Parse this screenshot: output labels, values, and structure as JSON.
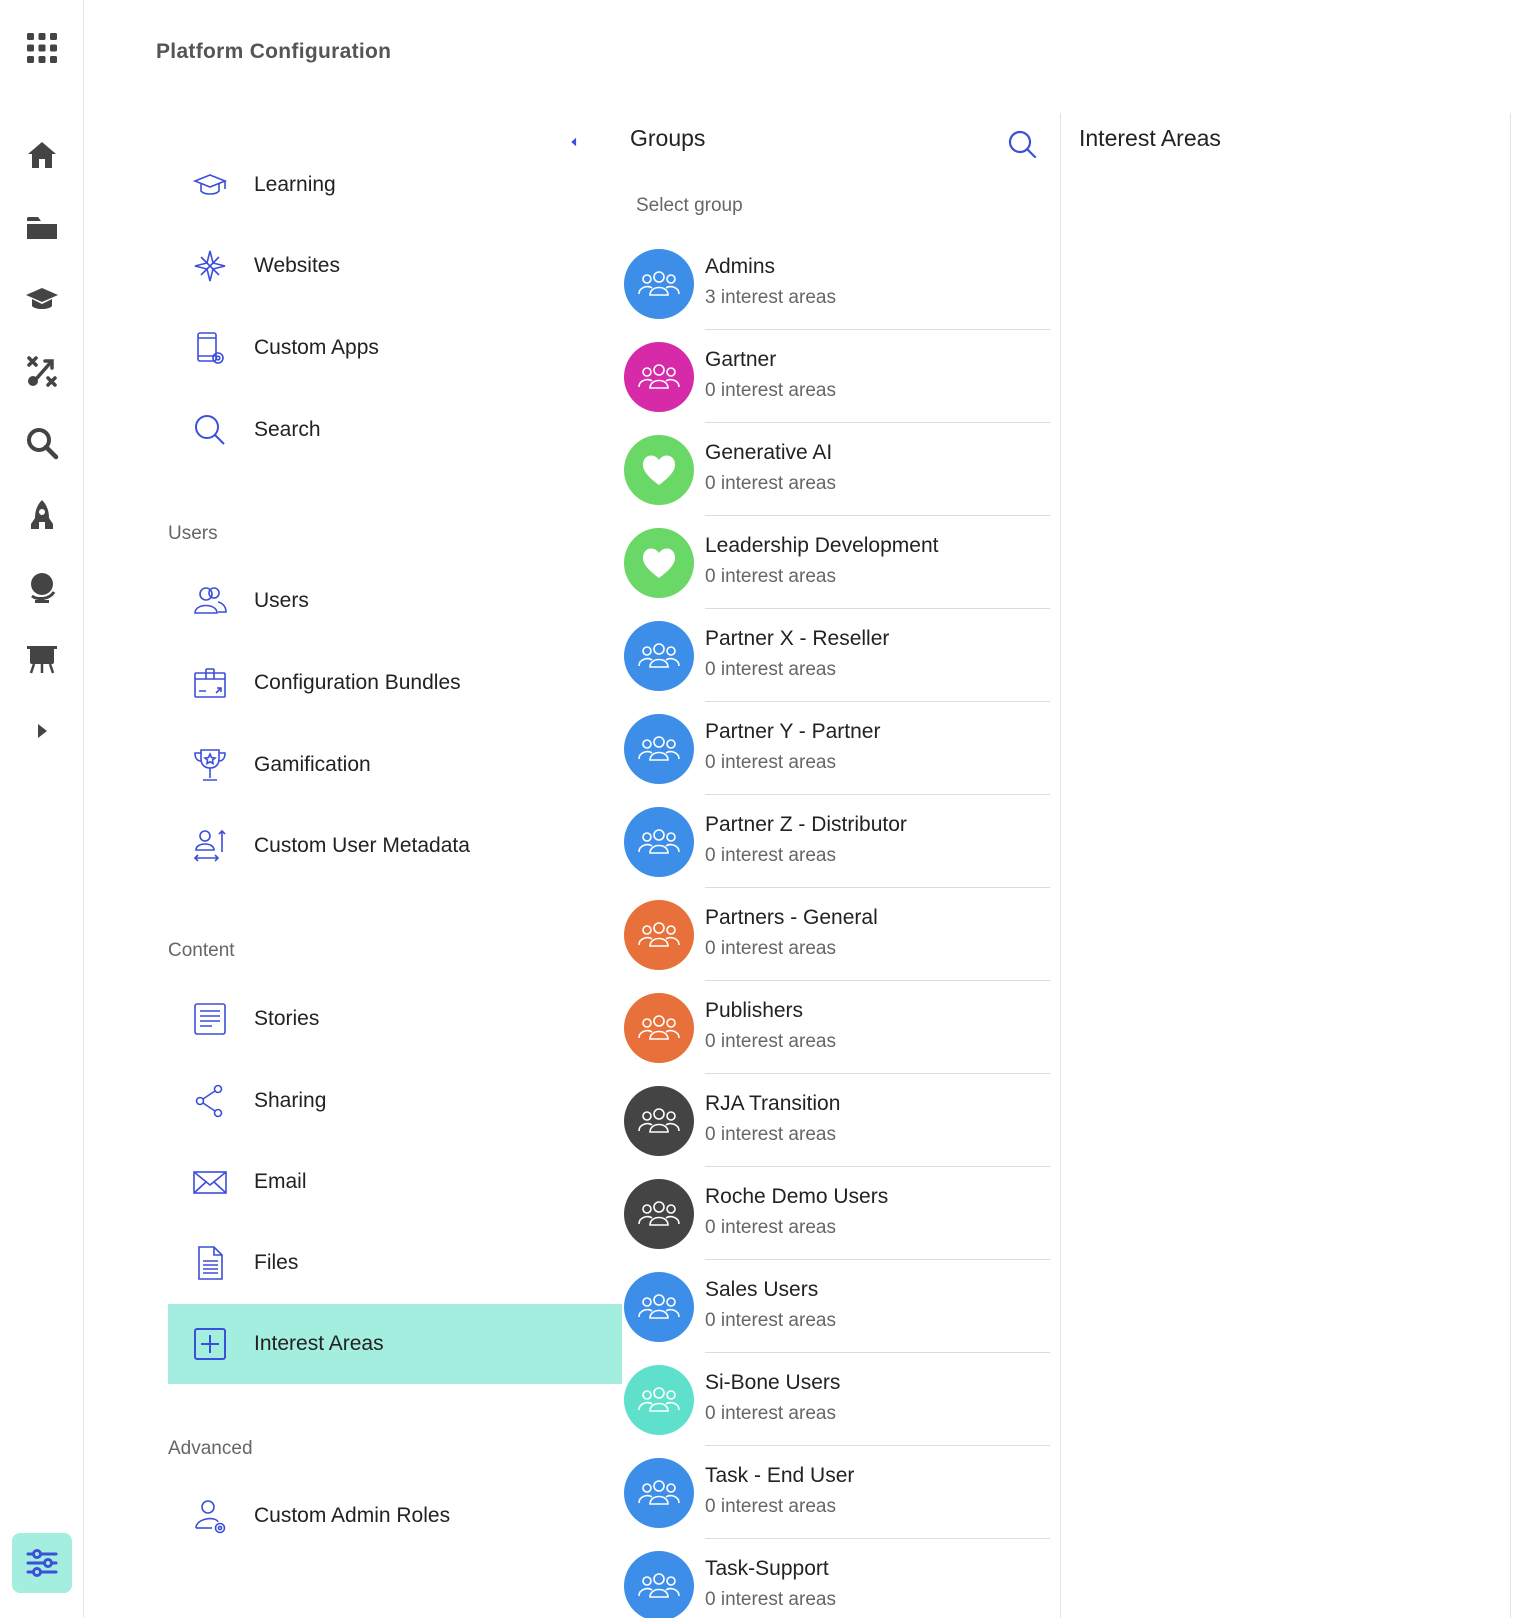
{
  "page_title": "Platform Configuration",
  "rail": {
    "icons": [
      "apps-grid-icon",
      "home-icon",
      "folder-icon",
      "graduation-cap-icon",
      "strategy-icon",
      "search-icon",
      "rocket-icon",
      "globe-icon",
      "presentation-icon",
      "expand-arrow-icon",
      "settings-sliders-icon"
    ]
  },
  "nav": {
    "items_top": [
      {
        "label": "Learning",
        "icon": "graduation-cap-icon"
      },
      {
        "label": "Websites",
        "icon": "compass-icon"
      },
      {
        "label": "Custom Apps",
        "icon": "custom-app-icon"
      },
      {
        "label": "Search",
        "icon": "search-icon"
      }
    ],
    "users_section": "Users",
    "items_users": [
      {
        "label": "Users",
        "icon": "users-icon"
      },
      {
        "label": "Configuration Bundles",
        "icon": "bundle-icon"
      },
      {
        "label": "Gamification",
        "icon": "trophy-icon"
      },
      {
        "label": "Custom User Metadata",
        "icon": "user-metadata-icon"
      }
    ],
    "content_section": "Content",
    "items_content": [
      {
        "label": "Stories",
        "icon": "stories-icon"
      },
      {
        "label": "Sharing",
        "icon": "share-icon"
      },
      {
        "label": "Email",
        "icon": "email-icon"
      },
      {
        "label": "Files",
        "icon": "file-icon"
      },
      {
        "label": "Interest Areas",
        "icon": "plus-square-icon",
        "active": true
      }
    ],
    "advanced_section": "Advanced",
    "items_advanced": [
      {
        "label": "Custom Admin Roles",
        "icon": "admin-role-icon"
      }
    ]
  },
  "groups": {
    "title": "Groups",
    "select_label": "Select group",
    "items": [
      {
        "name": "Admins",
        "count": "3 interest areas",
        "color": "#3d8ee8",
        "icon": "group-icon"
      },
      {
        "name": "Gartner",
        "count": "0 interest areas",
        "color": "#d62aa8",
        "icon": "group-icon"
      },
      {
        "name": "Generative AI",
        "count": "0 interest areas",
        "color": "#6ad866",
        "icon": "heart-icon"
      },
      {
        "name": "Leadership Development",
        "count": "0 interest areas",
        "color": "#6ad866",
        "icon": "heart-icon"
      },
      {
        "name": "Partner X - Reseller",
        "count": "0 interest areas",
        "color": "#3d8ee8",
        "icon": "group-icon"
      },
      {
        "name": "Partner Y - Partner",
        "count": "0 interest areas",
        "color": "#3d8ee8",
        "icon": "group-icon"
      },
      {
        "name": "Partner Z - Distributor",
        "count": "0 interest areas",
        "color": "#3d8ee8",
        "icon": "group-icon"
      },
      {
        "name": "Partners - General",
        "count": "0 interest areas",
        "color": "#e8703a",
        "icon": "group-icon"
      },
      {
        "name": "Publishers",
        "count": "0 interest areas",
        "color": "#e8703a",
        "icon": "group-icon"
      },
      {
        "name": "RJA Transition",
        "count": "0 interest areas",
        "color": "#444444",
        "icon": "group-icon"
      },
      {
        "name": "Roche Demo Users",
        "count": "0 interest areas",
        "color": "#444444",
        "icon": "group-icon"
      },
      {
        "name": "Sales Users",
        "count": "0 interest areas",
        "color": "#3d8ee8",
        "icon": "group-icon"
      },
      {
        "name": "Si-Bone Users",
        "count": "0 interest areas",
        "color": "#5fe0cc",
        "icon": "group-icon"
      },
      {
        "name": "Task - End User",
        "count": "0 interest areas",
        "color": "#3d8ee8",
        "icon": "group-icon"
      },
      {
        "name": "Task-Support",
        "count": "0 interest areas",
        "color": "#3d8ee8",
        "icon": "group-icon"
      }
    ]
  },
  "interest_areas": {
    "title": "Interest Areas"
  },
  "colors": {
    "accent": "#3b4fd8",
    "active_bg": "#a4eee0",
    "rail_icon": "#444444"
  }
}
